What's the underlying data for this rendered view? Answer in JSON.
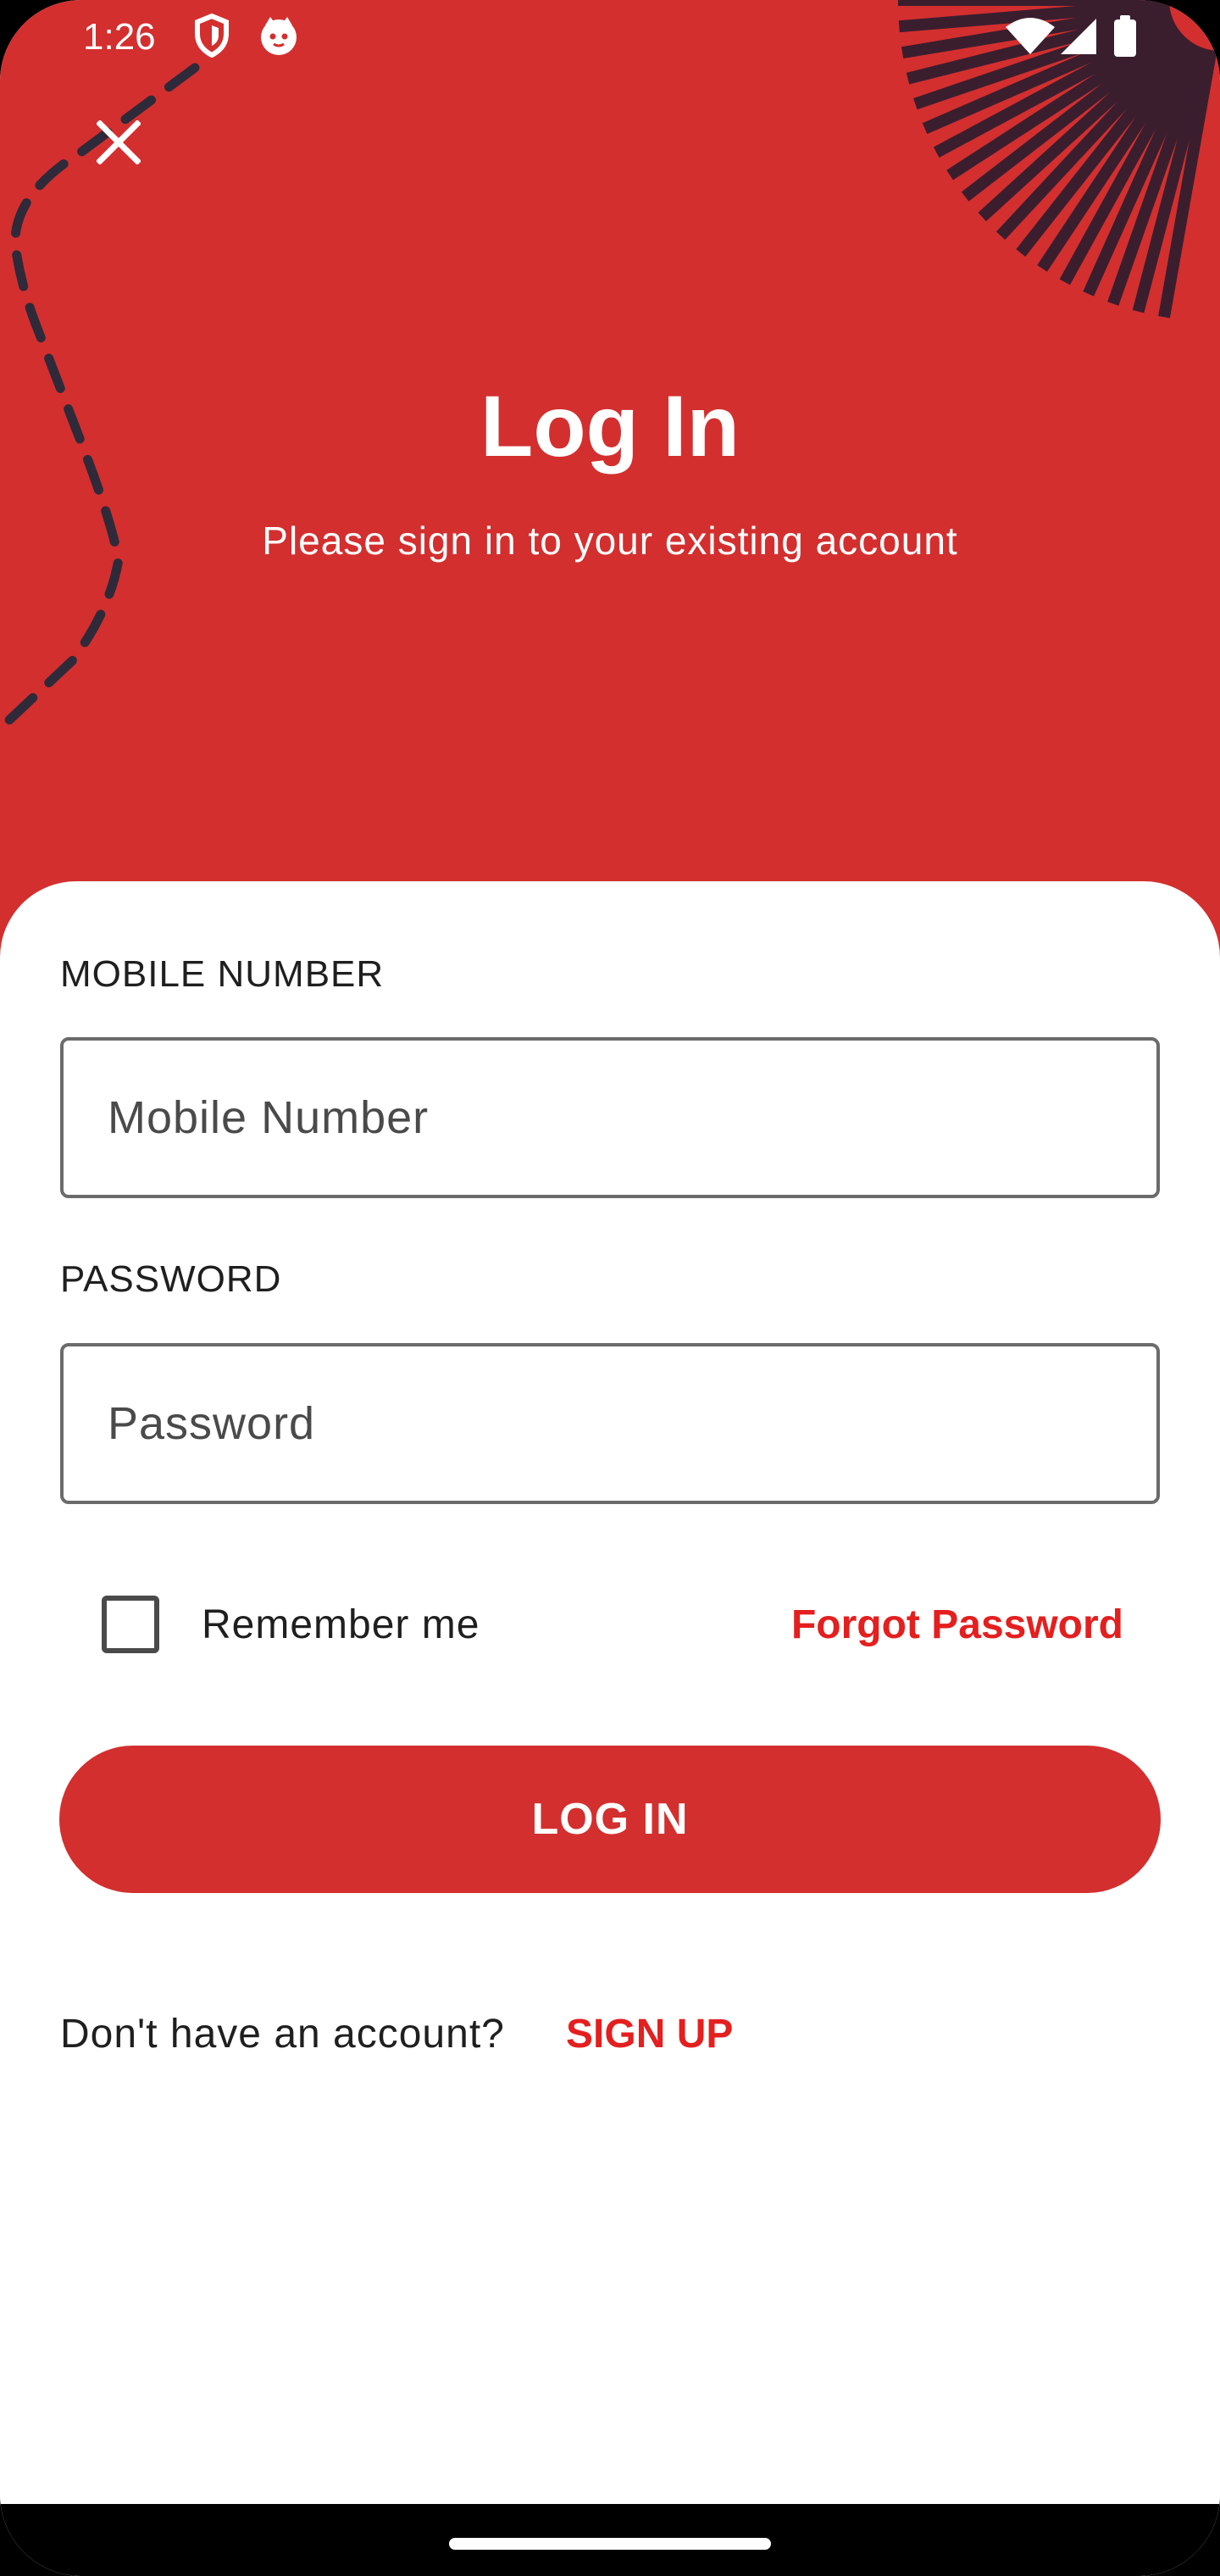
{
  "status_bar": {
    "time": "1:26",
    "left_icons": [
      "shield-icon",
      "cat-face-icon"
    ],
    "right_icons": [
      "wifi-icon",
      "signal-icon",
      "battery-icon"
    ]
  },
  "header": {
    "close_icon": "close-icon",
    "title": "Log In",
    "subtitle": "Please sign in to your existing account"
  },
  "form": {
    "mobile_label": "MOBILE NUMBER",
    "mobile_placeholder": "Mobile Number",
    "mobile_value": "",
    "password_label": "PASSWORD",
    "password_placeholder": "Password",
    "password_value": "",
    "remember_label": "Remember me",
    "remember_checked": false,
    "forgot_label": "Forgot Password",
    "login_label": "LOG IN",
    "signup_prompt": "Don't have an account?",
    "signup_label": "SIGN UP"
  },
  "colors": {
    "primary": "#d32f2f",
    "link": "#e41f1f",
    "decoration": "#3a1e2e",
    "text": "#1f1f1f"
  }
}
